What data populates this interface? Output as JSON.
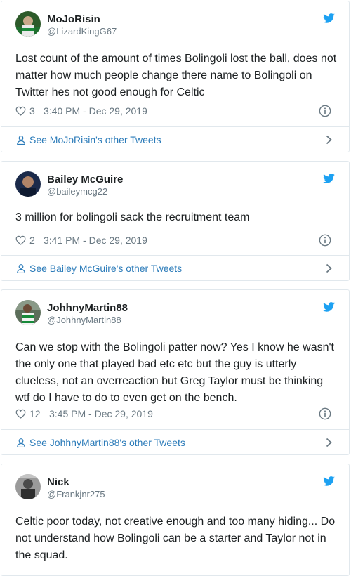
{
  "colors": {
    "link": "#2b7bb9",
    "muted": "#697882",
    "twitter_blue": "#1da1f2",
    "border": "#e1e8ed"
  },
  "icons": {
    "bird": "twitter-bird-icon",
    "heart": "heart-icon",
    "info": "info-icon",
    "user": "user-icon",
    "chevron": "chevron-right-icon"
  },
  "tweets": [
    {
      "name": "MoJoRisin",
      "handle": "@LizardKingG67",
      "text": "Lost count of the amount of times Bolingoli lost the ball, does not matter how much people change there name to Bolingoli on Twitter hes not good enough for Celtic",
      "likes": "3",
      "time": "3:40 PM - Dec 29, 2019",
      "see_more": "See MoJoRisin's other Tweets"
    },
    {
      "name": "Bailey McGuire",
      "handle": "@baileymcg22",
      "text": "3 million for bolingoli sack the recruitment team",
      "likes": "2",
      "time": "3:41 PM - Dec 29, 2019",
      "see_more": "See Bailey McGuire's other Tweets"
    },
    {
      "name": "JohhnyMartin88",
      "handle": "@JohhnyMartin88",
      "text": "Can we stop with the Bolingoli patter now? Yes I know he wasn't the only one that played bad etc etc but the guy is utterly clueless, not an overreaction but Greg Taylor must be thinking wtf do I have to do to even get on the bench.",
      "likes": "12",
      "time": "3:45 PM - Dec 29, 2019",
      "see_more": "See JohhnyMartin88's other Tweets"
    },
    {
      "name": "Nick",
      "handle": "@Frankjnr275",
      "text": "Celtic poor today, not creative enough and too many hiding... Do not understand how Bolingoli can be a starter and Taylor not in the squad."
    }
  ]
}
